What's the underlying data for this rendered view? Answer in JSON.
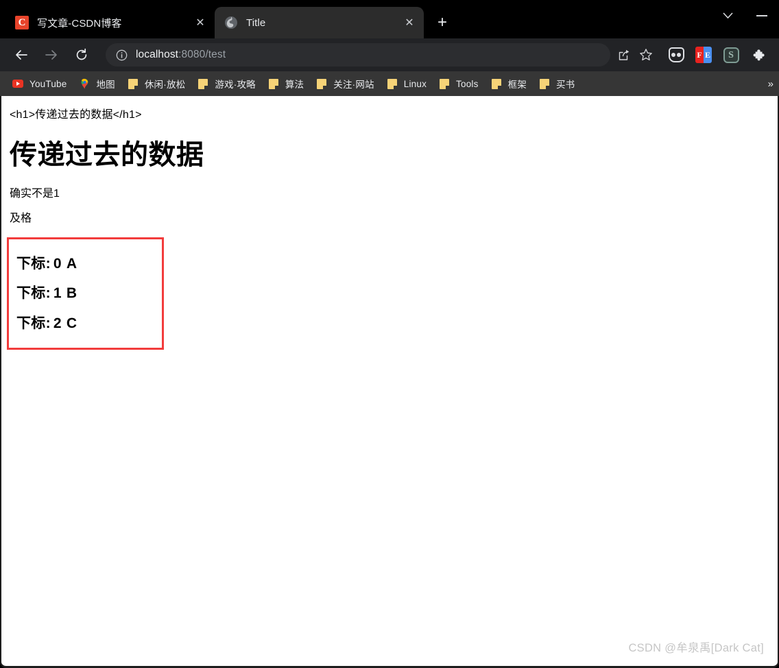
{
  "window": {
    "controls": [
      {
        "name": "chevron-down",
        "glyph": "∨"
      },
      {
        "name": "minimize",
        "glyph": "—"
      }
    ]
  },
  "tabstrip": {
    "tabs": [
      {
        "title": "写文章-CSDN博客",
        "favicon": "csdn-icon",
        "favicon_letter": "C",
        "active": false,
        "close_label": "✕"
      },
      {
        "title": "Title",
        "favicon": "globe-icon",
        "active": true,
        "close_label": "✕"
      }
    ],
    "new_tab_label": "+"
  },
  "toolbar": {
    "back_label": "←",
    "forward_label": "→",
    "reload_label": "⟳",
    "site_info_label": "ⓘ",
    "url_host": "localhost",
    "url_rest": ":8080/test",
    "url_full": "localhost:8080/test",
    "share_label": "share-icon",
    "bookmark_star_label": "☆",
    "extensions": [
      {
        "name": "pocket-extension-icon",
        "label": ""
      },
      {
        "name": "fe-extension-icon",
        "label_left": "F",
        "label_right": "E"
      },
      {
        "name": "s-extension-icon",
        "label": "S"
      },
      {
        "name": "extensions-puzzle-icon",
        "label": "✦"
      }
    ]
  },
  "bookmarks": {
    "items": [
      {
        "label": "YouTube",
        "icon": "youtube-icon"
      },
      {
        "label": "地图",
        "icon": "maps-pin-icon"
      },
      {
        "label": "休闲·放松",
        "icon": "folder-icon"
      },
      {
        "label": "游戏·攻略",
        "icon": "folder-icon"
      },
      {
        "label": "算法",
        "icon": "folder-icon"
      },
      {
        "label": "关注·网站",
        "icon": "folder-icon"
      },
      {
        "label": "Linux",
        "icon": "folder-icon"
      },
      {
        "label": "Tools",
        "icon": "folder-icon"
      },
      {
        "label": "框架",
        "icon": "folder-icon"
      },
      {
        "label": "买书",
        "icon": "folder-icon"
      }
    ],
    "overflow_label": "»"
  },
  "page": {
    "code_line": "<h1>传递过去的数据</h1>",
    "heading": "传递过去的数据",
    "paragraph1": "确实不是1",
    "paragraph2": "及格",
    "box_border_color": "#f23c3c",
    "rows": [
      {
        "label": "下标:",
        "index": "0",
        "value": "A"
      },
      {
        "label": "下标:",
        "index": "1",
        "value": "B"
      },
      {
        "label": "下标:",
        "index": "2",
        "value": "C"
      }
    ],
    "watermark": "CSDN @牟泉禹[Dark Cat]"
  }
}
